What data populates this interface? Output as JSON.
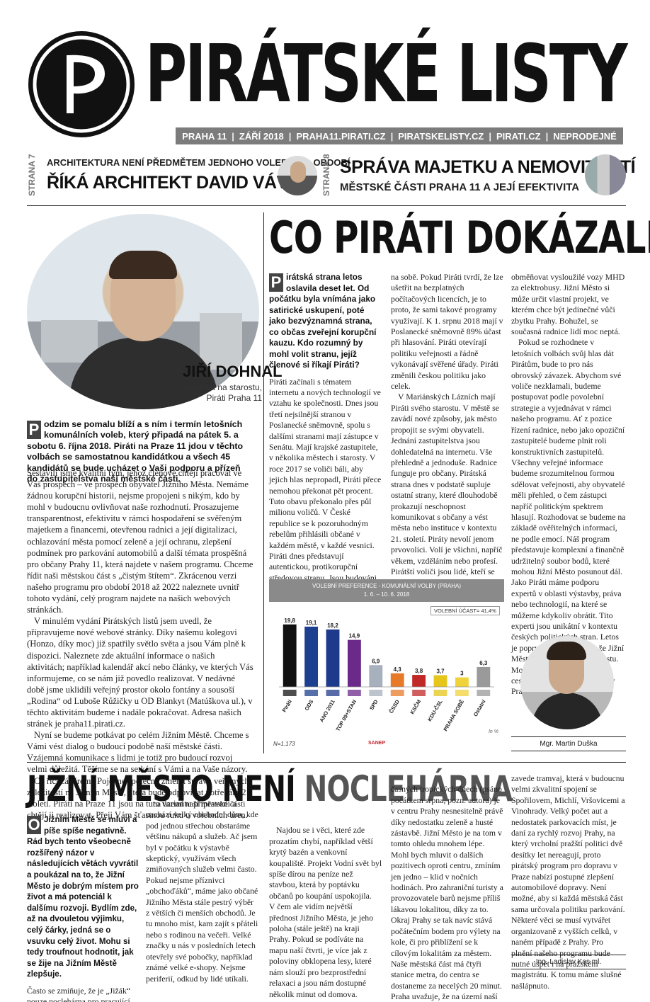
{
  "masthead": {
    "title": "PIRÁTSKÉ LISTY",
    "info": [
      "PRAHA 11",
      "ZÁŘÍ 2018",
      "PRAHA11.PIRATI.CZ",
      "PIRATSKELISTY.CZ",
      "PIRATI.CZ",
      "NEPRODEJNÉ"
    ],
    "separator": "|"
  },
  "teasers": [
    {
      "page": "STRANA 7",
      "small": "ARCHITEKTURA NENÍ PŘEDMĚTEM JEDNOHO VOLEBNÍHO OBDOBÍ",
      "big": "ŘÍKÁ ARCHITEKT DAVID VÁVRA"
    },
    {
      "page": "STRANA 8",
      "big": "SPRÁVA MAJETKU A NEMOVITOSTÍ",
      "small": "MĚSTSKÉ ČÁSTI PRAHA 11 A JEJÍ EFEKTIVITA"
    }
  ],
  "left": {
    "name": "JIŘÍ DOHNAL",
    "role": [
      "kandidát na starostu,",
      "Piráti Praha 11"
    ],
    "lead_initial": "P",
    "lead": "odzim se pomalu blíží a s ním i termín letošních komunálních voleb, který připadá na pátek 5. a sobotu 6. října 2018. Piráti na Praze 11 jdou v těchto volbách se samostatnou kandidátkou a všech 45 kandidátů se bude ucházet o Vaši podporu a přízeň do zastupitelstva naší městské části.",
    "paragraphs": [
      "Sestavili jsme kvalitní tým, jehož členové chtějí pracovat ve Váš prospěch – ve prospěch obyvatel Jižního Města. Nemáme žádnou korupční historii, nejsme propojeni s nikým, kdo by mohl v budoucnu ovlivňovat naše rozhodnutí. Prosazujeme transparentnost, efektivitu v rámci hospodaření se svěřeným majetkem a financemi, otevřenou radnici a její digitalizaci, ochlazování města pomocí zeleně a její ochranu, zlepšení podmínek pro parkování automobilů a další témata prospěšná pro občany Prahy 11, která najdete v našem programu. Chceme řídit naši městskou část s „čistým štítem“. Zkrácenou verzi našeho programu pro období 2018 až 2022 naleznete uvnitř tohoto vydání, celý program najdete na našich webových stránkách.",
      "V minulém vydání Pirátských listů jsem uvedl, že připravujeme nové webové stránky. Díky našemu kolegovi (Honzo, díky moc) již spatřily světlo světa a jsou Vám plně k dispozici. Naleznete zde aktuální informace o našich aktivitách; například kalendář akcí nebo články, ve kterých Vás informujeme, co se nám již povedlo realizovat. V nedávné době jsme uklidili veřejný prostor okolo fontány a sousoší „Rodina“ od Luboše Růžičky u OD Blankyt (Matúškova ul.), v těchto aktivitám budeme i nadále pokračovat. Adresa našich stránek je praha11.pirati.cz.",
      "Nyní se budeme potkávat po celém Jižním Městě. Chceme s Vámi vést dialog o budoucí podobě naší městské části. Vzájemná komunikace s lidmi je totiž pro budoucí rozvoj velmi důležitá. Těšíme se na setkání s Vámi a na Vaše názory.",
      "Co říci závěrem? Pojďme společně změnit správu veřejných záležitostí na Jižním Městě, která bude odpovídat potřebám 21. století. Piráti na Praze 11 jsou na tuto variantu připraveni a chtějí ji realizovat. Přeji Vám šťastnou ruku u volebních uren."
    ]
  },
  "main": {
    "headline": "CO PIRÁTI DOKÁZALI?",
    "lead_initial": "P",
    "lead": "irátská strana letos oslavila deset let. Od počátku byla vnímána jako satirické uskupení, poté jako bezvýznamná strana, co občas zveřejní korupční kauzu. Kdo rozumný by mohl volit stranu, jejíž členové si říkají Piráti?",
    "col_a": [
      "Piráti začínali s tématem internetu a nových technologií ve vztahu ke společnosti. Dnes jsou třetí nejsilnější stranou v Poslanecké sněmovně, spolu s dalšími stranami mají zástupce v Senátu. Mají krajské zastupitele, v několika městech i starosty. V roce 2017 se voliči báli, aby jejich hlas nepropadl, Piráti přece nemohou překonat pět procent. Tuto obavu překonalo přes půl milionu voličů. V České republice se k pozoruhodným rebelům přihlásili občané v každém městě, v každé vesnici. Piráti dnes představují autentickou, protikorupční středovou stranu. Jsou budováni zdola. Nestojí za nimi žádný velký sponzor. Všechny své smlouvy a peněžní transakce zveřejňují na svém webu. Protikorupční metody aplikují v první řadě sami"
    ],
    "col_b": [
      "na sobě. Pokud Piráti tvrdí, že lze ušetřit na bezplatných počítačových licencích, je to proto, že sami takové programy využívají. K 1. srpnu 2018 mají v Poslanecké sněmovně 89% účast při hlasování. Piráti otevírají politiku veřejnosti a řádně vykonávají svěřené úřady. Piráti změnili českou politiku jako celek.",
      "V Mariánských Lázních mají Piráti svého starostu. V městě se zavádí nové způsoby, jak město propojit se svými obyvateli. Jednání zastupitelstva jsou dohledatelná na internetu. Vše přehledně a jednoduše. Radnice funguje pro občany. Pirátská strana dnes v podstatě supluje ostatní strany, které dlouhodobě prokazují neschopnost komunikovat s občany a vést města nebo instituce v kontextu 21. století. Piráty nevolí jenom prvovolici. Volí je všichni, napříč věkem, vzděláním nebo profesí. Pirátští voliči jsou lidé, kteří se nesmíří se současnou stagnací. Rebelové duchem, kteří vidí, jak evropská města přinášejí nové věci v dopravě, v péči o zeleň nebo upravují radnice k potřebám obyvatel. Varšava se například rozhodla"
    ],
    "col_c": [
      "obměňovat vysloužilé vozy MHD za elektrobusy. Jižní Město si může určit vlastní projekt, ve kterém chce být jedinečné vůči zbytku Prahy. Bohužel, se současná radnice lidí moc neptá.",
      "Pokud se rozhodnete v letošních volbách svůj hlas dát Pirátům, bude to pro nás obrovský závazek. Abychom své voliče nezklamali, budeme postupovat podle povolební strategie a vyjednávat v rámci našeho programu. Ať z pozice řízení radnice, nebo jako opoziční zastupitelé budeme plnit roli konstruktivních zastupitelů. Všechny veřejné informace budeme srozumitelnou formou sdělovat veřejnosti, aby obyvatelé měli přehled, o čem zástupci napříč politickým spektrem hlasují. Rozhodovat se budeme na základě ověřitelných informací, ne podle emocí. Náš program představuje komplexní a finančně udržitelný soubor bodů, které mohou Jižní Město posunout dál. Jako Piráti máme podporu expertů v oblasti výstavby, práva nebo technologií, na které se můžeme kdykoliv obrátit. Tito experti jsou unikátní v kontextu českých politických stran. Letos je poprvé skutečná šance, že Jižní Město získá pirátského starostu. Možná to bude první krok na cestě k nejlepší městské části v Praze."
    ],
    "duska_caption": "Mgr. Martin Duška"
  },
  "chart_data": {
    "type": "bar",
    "title": "VOLEBNÍ PREFERENCE - KOMUNÁLNÍ VOLBY (PRAHA)",
    "subtitle": "1. 6. – 10. 6. 2018",
    "categories": [
      "Piráti",
      "ODS",
      "ANO 2011",
      "TOP 09+STAN",
      "SPD",
      "ČSSD",
      "KSČM",
      "KDU-ČSL",
      "PRAHA SOBĚ",
      "Ostatní"
    ],
    "values": [
      19.8,
      19.1,
      18.2,
      14.9,
      6.9,
      4.3,
      3.8,
      3.7,
      3,
      6.3
    ],
    "value_labels": [
      "19,8",
      "19,1",
      "18,2",
      "14,9",
      "6,9",
      "4,3",
      "3,8",
      "3,7",
      "3",
      "6,3"
    ],
    "colors": [
      "#111111",
      "#1c3f8f",
      "#1e3a8a",
      "#6b2a8a",
      "#a7b0bd",
      "#e77a29",
      "#c12828",
      "#e6c61a",
      "#f0d23a",
      "#9a9a9a"
    ],
    "turnout": "VOLEBNÍ ÚČAST= 41,4%",
    "note": "N=1.173",
    "unit": "In %",
    "source": "SANEP",
    "ylim": [
      0,
      22
    ]
  },
  "bottom": {
    "headline_a": "JIŽNÍ MĚSTO NENÍ ",
    "headline_b": "NOCLEHÁRNA",
    "lead_initial": "O",
    "lead": "Jižním Městě se mluví a píše spíše negativně. Rád bych tento všeobecně rozšířený názor v následujících větách vyvrátil a poukázal na to, že Jižní Město je dobrým místem pro život a má potenciál k dalšímu rozvoji. Bydlím zde, až na dvouletou výjimku, celý čárky, jedná se o vsuvku celý život. Mohu si tedy troufnout hodnotit, jak se žije na Jižním Městě zlepšuje.",
    "col1_tail": "Často se zmiňuje, že je „Jižák“ pouze noclehárna pro pracující, že tu chybí občanská vybavenost. Přitom se",
    "col2": "na území naší městské části nachází velký obchodní dům, kde pod jednou střechou obstaráme většinu nákupů a služeb. Ač jsem byl v počátku k výstavbě skeptický, využívám všech zmiňovaných služeb velmi často. Pokud nejsme příznivci „obchoďáků“, máme jako občané Jižního Města stále pestrý výběr z větších či menších obchodů. Je tu mnoho míst, kam zajít s přáteli nebo s rodinou na večeři. Velké značky u nás v posledních letech otevřely své pobočky, například známé velké e-shopy. Nejsme periferií, odkud by lidé utíkali.",
    "col3": "Najdou se i věci, které zde prozatím chybí, například větší krytý bazén a venkovní koupaliště. Projekt Vodní svět byl spíše dírou na peníze než stavbou, která by poptávku občanů po koupání uspokojila.\nV čem ale vidím největší přednost Jižního Města, je jeho poloha (stále ještě) na kraji Prahy. Pokud se podíváte na mapu naší čtvrti, je více jak z poloviny obklopena lesy, které nám slouží pro bezprostřední relaxaci a jsou nám dostupné několik minut od domova. Občané z jiných částí Prahy mohou tiše závidět. V sou-",
    "col4": "časných tropických dnech (psáno počátkem srpna, pozn. autora) je v centru Prahy nesnesitelně právě díky nedostatku zeleně a husté zástavbě. Jižní Město je na tom v tomto ohledu mnohem lépe. Mohl bych mluvit o dalších pozitivech oproti centru, zmíním jen jedno – klid v nočních hodinách. Pro zahraniční turisty a provozovatele barů nejsme příliš lákavou lokalitou, díky za to. Okraj Prahy se tak navíc stává počátečním bodem pro výlety na kole, či pro přiblížení se k cílovým lokalitám za městem.\nNaše městská část má čtyři stanice metra, do centra se dostaneme za necelých 20 minut. Praha uvažuje, že na území naší městské části",
    "col5": "zavede tramvaj, která v budoucnu velmi zkvalitní spojení se Spořilovem, Michlí, Vršovicemi a Vinohrady. Velký počet aut a nedostatek parkovacích míst, je daní za rychlý rozvoj Prahy, na který vrcholní pražští politici dvě desítky let nereagují, proto pirátský program pro dopravu v Praze nabízí postupné zlepšení automobilové dopravy. Není možné, aby si každá městská část sama určovala politiku parkování. Některé věci se musí vytvářet organizovaně z vyšších celků, v naném případě z Prahy. Pro plnění našeho programu bude nutné úspět i na pražském magistrátu. K tomu máme slušné našlápnuto.",
    "kos_caption": "Ing. Ladislav Kos ml."
  },
  "colors": {
    "bar_gray": "#7c7c7c",
    "ink": "#111111",
    "dropcap": "#444444"
  }
}
